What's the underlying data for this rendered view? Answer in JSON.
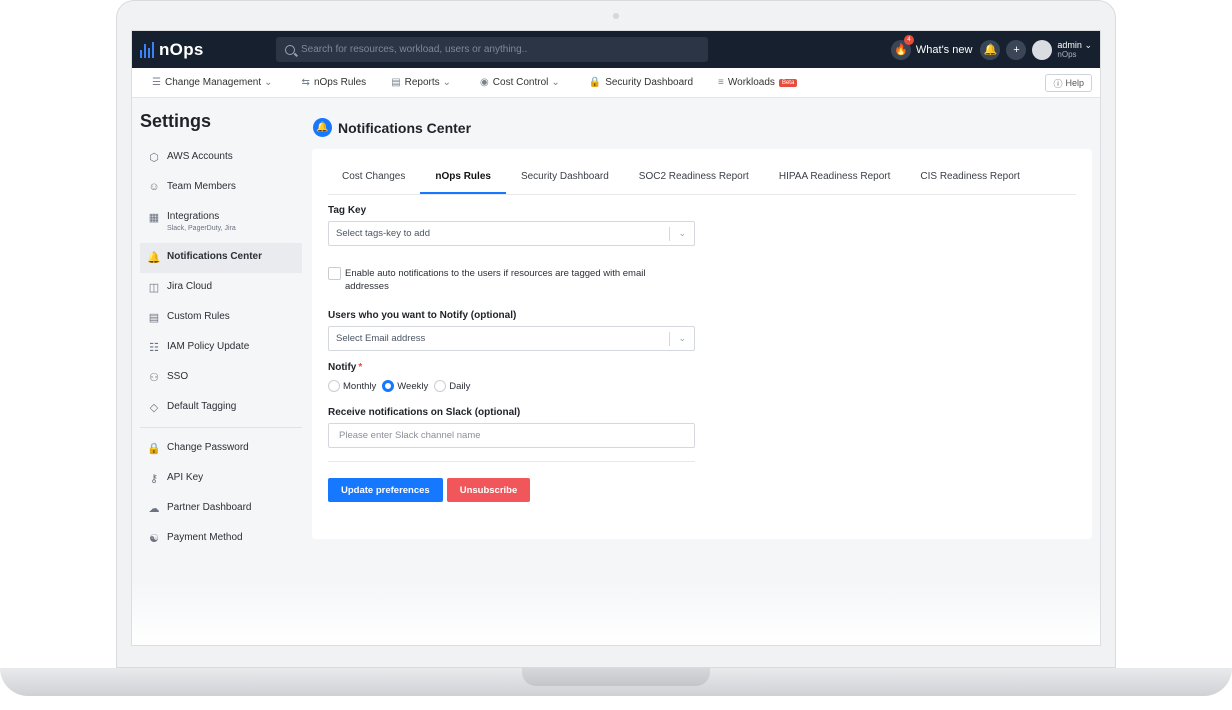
{
  "app": {
    "logo": "nOps"
  },
  "topbar": {
    "search_placeholder": "Search for resources, workload, users or anything..",
    "notif_count": "4",
    "whats_new": "What's new",
    "plus": "+",
    "user_name": "admin",
    "user_org": "nOps"
  },
  "nav": {
    "items": [
      {
        "label": "Change Management",
        "icon": "list-icon",
        "chevron": true
      },
      {
        "label": "nOps Rules",
        "icon": "arrows-icon"
      },
      {
        "label": "Reports",
        "icon": "document-icon",
        "chevron": true
      },
      {
        "label": "Cost Control",
        "icon": "coin-icon",
        "chevron": true
      },
      {
        "label": "Security Dashboard",
        "icon": "lock-icon"
      },
      {
        "label": "Workloads",
        "icon": "stack-icon",
        "badge": "Beta"
      }
    ],
    "help": "Help"
  },
  "sidebar": {
    "title": "Settings",
    "items": [
      {
        "label": "AWS Accounts",
        "icon": "cube-icon"
      },
      {
        "label": "Team Members",
        "icon": "users-icon"
      },
      {
        "label": "Integrations",
        "sub": "Slack, PagerDuty, Jira",
        "icon": "grid-icon"
      },
      {
        "label": "Notifications Center",
        "icon": "bell-icon",
        "active": true
      },
      {
        "label": "Jira Cloud",
        "icon": "columns-icon"
      },
      {
        "label": "Custom Rules",
        "icon": "rules-icon"
      },
      {
        "label": "IAM Policy Update",
        "icon": "policy-icon"
      },
      {
        "label": "SSO",
        "icon": "sso-icon"
      },
      {
        "label": "Default Tagging",
        "icon": "tag-icon"
      }
    ],
    "items2": [
      {
        "label": "Change Password",
        "icon": "lock-icon"
      },
      {
        "label": "API Key",
        "icon": "key-icon"
      },
      {
        "label": "Partner Dashboard",
        "icon": "handshake-icon"
      },
      {
        "label": "Payment Method",
        "icon": "payment-icon"
      }
    ]
  },
  "page": {
    "title": "Notifications Center",
    "tabs": [
      "Cost Changes",
      "nOps Rules",
      "Security Dashboard",
      "SOC2 Readiness Report",
      "HIPAA Readiness Report",
      "CIS Readiness Report"
    ],
    "active_tab": "nOps Rules"
  },
  "form": {
    "tag_key_label": "Tag Key",
    "tag_key_placeholder": "Select tags-key to add",
    "auto_notify_text": "Enable auto notifications to the users if resources are tagged with email addresses",
    "users_label": "Users who you want to Notify (optional)",
    "users_placeholder": "Select Email address",
    "notify_label": "Notify",
    "notify_required": "*",
    "notify_options": [
      "Monthly",
      "Weekly",
      "Daily"
    ],
    "notify_selected": "Weekly",
    "slack_label": "Receive notifications on Slack (optional)",
    "slack_placeholder": "Please enter Slack channel name",
    "update_button": "Update preferences",
    "unsubscribe_button": "Unsubscribe"
  },
  "colors": {
    "accent": "#1677ff",
    "danger": "#f0565a",
    "topbar": "#17202e"
  }
}
